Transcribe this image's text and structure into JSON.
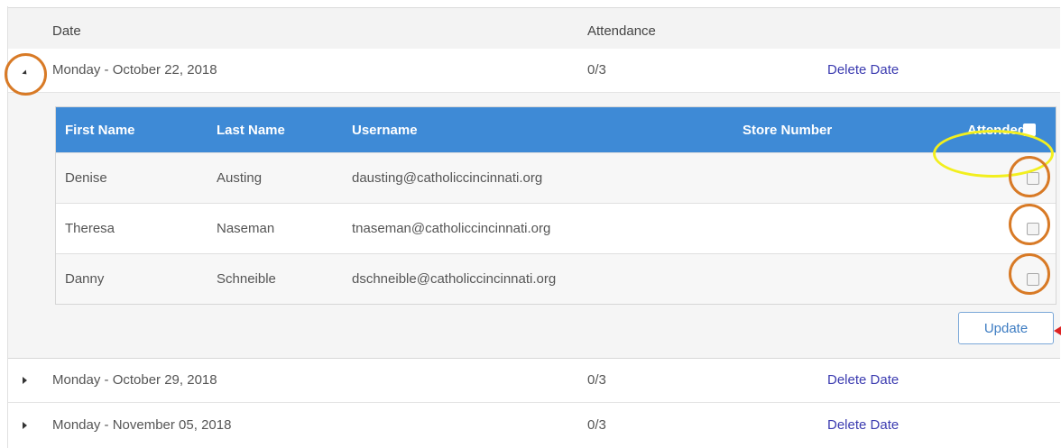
{
  "header": {
    "date_label": "Date",
    "attendance_label": "Attendance"
  },
  "rows": [
    {
      "date": "Monday - October 22, 2018",
      "attendance": "0/3",
      "action": "Delete Date",
      "expanded": true
    },
    {
      "date": "Monday - October 29, 2018",
      "attendance": "0/3",
      "action": "Delete Date",
      "expanded": false
    },
    {
      "date": "Monday - November 05, 2018",
      "attendance": "0/3",
      "action": "Delete Date",
      "expanded": false
    }
  ],
  "attendees_table": {
    "columns": [
      "First Name",
      "Last Name",
      "Username",
      "Store Number",
      "Attended"
    ],
    "rows": [
      {
        "first": "Denise",
        "last": "Austing",
        "username": "dausting@catholiccincinnati.org",
        "store": "",
        "attended": false
      },
      {
        "first": "Theresa",
        "last": "Naseman",
        "username": "tnaseman@catholiccincinnati.org",
        "store": "",
        "attended": false
      },
      {
        "first": "Danny",
        "last": "Schneible",
        "username": "dschneible@catholiccincinnati.org",
        "store": "",
        "attended": false
      }
    ]
  },
  "update_label": "Update",
  "colors": {
    "header_blue": "#3e8ad6",
    "link": "#3b3bb0",
    "annotation_orange": "#d87a26",
    "annotation_yellow": "#f2ef1e"
  }
}
